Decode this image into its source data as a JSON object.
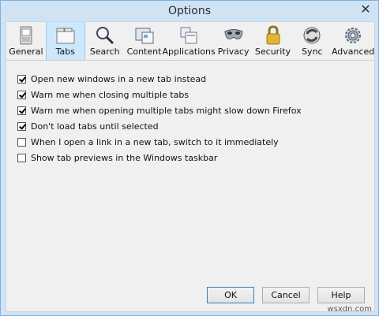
{
  "window": {
    "title": "Options"
  },
  "tabs": [
    {
      "label": "General",
      "icon": "general-icon"
    },
    {
      "label": "Tabs",
      "icon": "tabs-icon",
      "selected": true
    },
    {
      "label": "Search",
      "icon": "search-icon"
    },
    {
      "label": "Content",
      "icon": "content-icon"
    },
    {
      "label": "Applications",
      "icon": "applications-icon"
    },
    {
      "label": "Privacy",
      "icon": "privacy-mask-icon"
    },
    {
      "label": "Security",
      "icon": "lock-icon"
    },
    {
      "label": "Sync",
      "icon": "sync-icon"
    },
    {
      "label": "Advanced",
      "icon": "gear-icon"
    }
  ],
  "options": [
    {
      "label": "Open new windows in a new tab instead",
      "checked": true
    },
    {
      "label": "Warn me when closing multiple tabs",
      "checked": true
    },
    {
      "label": "Warn me when opening multiple tabs might slow down Firefox",
      "checked": true
    },
    {
      "label": "Don't load tabs until selected",
      "checked": true
    },
    {
      "label": "When I open a link in a new tab, switch to it immediately",
      "checked": false
    },
    {
      "label": "Show tab previews in the Windows taskbar",
      "checked": false
    }
  ],
  "buttons": {
    "ok": "OK",
    "cancel": "Cancel",
    "help": "Help"
  },
  "watermark": "wsxdn.com"
}
